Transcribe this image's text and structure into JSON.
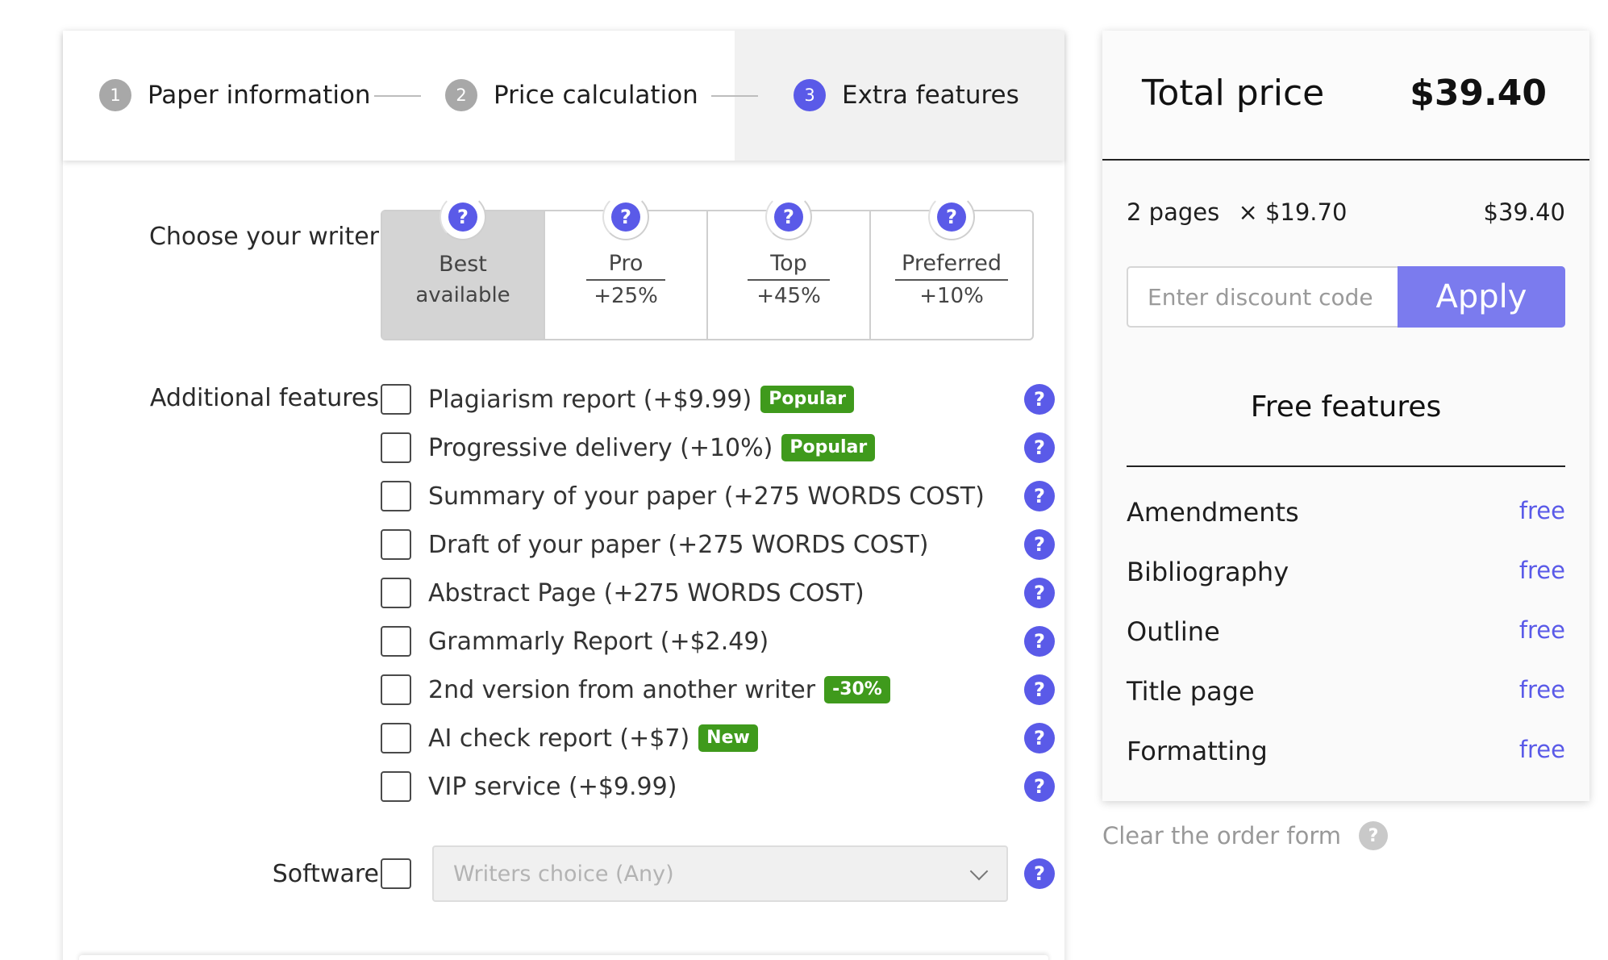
{
  "stepper": {
    "steps": [
      {
        "num": "1",
        "label": "Paper information"
      },
      {
        "num": "2",
        "label": "Price calculation"
      },
      {
        "num": "3",
        "label": "Extra features"
      }
    ]
  },
  "writer": {
    "label": "Choose your writer",
    "options": [
      {
        "name": "Best",
        "pct": "available"
      },
      {
        "name": "Pro",
        "pct": "+25%"
      },
      {
        "name": "Top",
        "pct": "+45%"
      },
      {
        "name": "Preferred",
        "pct": "+10%"
      }
    ],
    "help": "?"
  },
  "features": {
    "label": "Additional features",
    "items": [
      {
        "text": "Plagiarism report (+$9.99)",
        "badge": "Popular"
      },
      {
        "text": "Progressive delivery (+10%)",
        "badge": "Popular"
      },
      {
        "text": "Summary of your paper (+275 WORDS COST)",
        "badge": ""
      },
      {
        "text": "Draft of your paper (+275 WORDS COST)",
        "badge": ""
      },
      {
        "text": "Abstract Page (+275 WORDS COST)",
        "badge": ""
      },
      {
        "text": "Grammarly Report (+$2.49)",
        "badge": ""
      },
      {
        "text": "2nd version from another writer",
        "badge": "-30%"
      },
      {
        "text": "AI check report (+$7)",
        "badge": "New"
      },
      {
        "text": "VIP service (+$9.99)",
        "badge": ""
      }
    ]
  },
  "software": {
    "label": "Software",
    "selected": "Writers choice (Any)"
  },
  "summary": {
    "total_label": "Total price",
    "total_value": "$39.40",
    "pages": "2 pages",
    "unit_price": "× $19.70",
    "line_total": "$39.40",
    "discount_placeholder": "Enter discount code",
    "apply_label": "Apply",
    "free_title": "Free features",
    "free_items": [
      {
        "name": "Amendments",
        "value": "free"
      },
      {
        "name": "Bibliography",
        "value": "free"
      },
      {
        "name": "Outline",
        "value": "free"
      },
      {
        "name": "Title page",
        "value": "free"
      },
      {
        "name": "Formatting",
        "value": "free"
      }
    ],
    "clear_label": "Clear the order form"
  },
  "colors": {
    "accent": "#5a5ae8",
    "apply_button": "#7b7bee",
    "badge_green": "#3f9a1c",
    "step_inactive": "#a8a8a8"
  }
}
